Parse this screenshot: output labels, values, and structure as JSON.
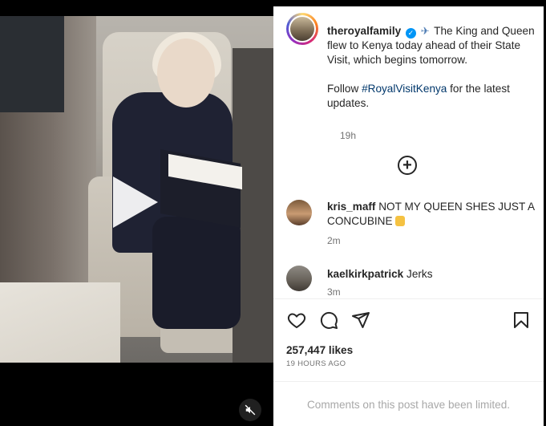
{
  "post": {
    "username": "theroyalfamily",
    "caption_body": "The King and Queen flew to Kenya today ahead of their State Visit, which begins tomorrow.",
    "caption_follow_prefix": "Follow ",
    "caption_hashtag": "#RoyalVisitKenya",
    "caption_follow_suffix": " for the latest updates.",
    "caption_time": "19h",
    "likes": "257,447 likes",
    "date": "19 HOURS AGO",
    "comments_limited": "Comments on this post have been limited.",
    "icons": {
      "verified": "verified-badge-icon",
      "plane": "airplane-emoji-icon",
      "load_more": "plus-circle-icon",
      "like": "heart-icon",
      "comment": "comment-bubble-icon",
      "share": "paper-plane-icon",
      "save": "bookmark-icon",
      "play": "play-icon",
      "mute": "muted-speaker-icon"
    }
  },
  "comments": [
    {
      "username": "kris_maff",
      "text": "NOT MY QUEEN SHES JUST A CONCUBINE",
      "emoji": "raised-fist-emoji",
      "time": "2m"
    },
    {
      "username": "kaelkirkpatrick",
      "text": "Jerks",
      "time": "3m"
    }
  ],
  "colors": {
    "text": "#262626",
    "secondary": "#737373",
    "hashtag": "#00376b",
    "verified": "#0095f6",
    "muted_text": "#a8a8a8"
  }
}
